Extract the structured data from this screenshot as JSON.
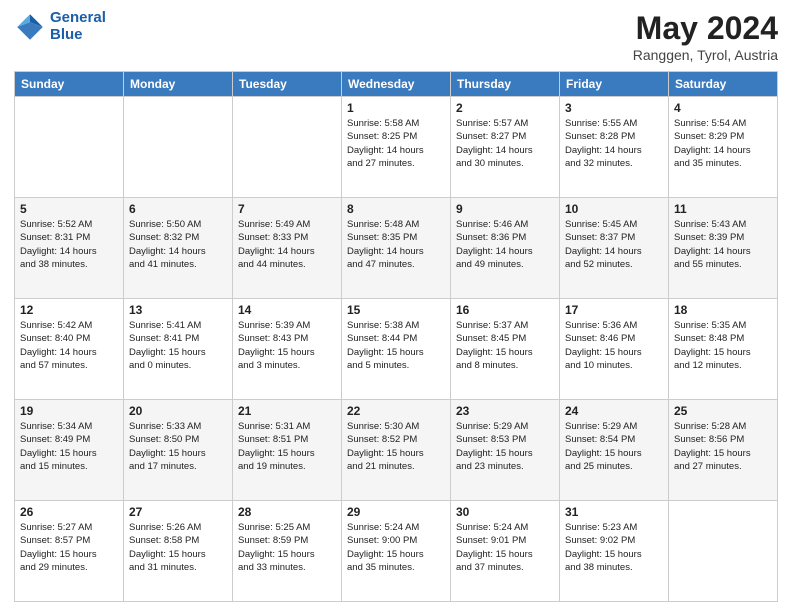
{
  "header": {
    "logo_line1": "General",
    "logo_line2": "Blue",
    "title": "May 2024",
    "location": "Ranggen, Tyrol, Austria"
  },
  "weekdays": [
    "Sunday",
    "Monday",
    "Tuesday",
    "Wednesday",
    "Thursday",
    "Friday",
    "Saturday"
  ],
  "weeks": [
    [
      {
        "day": "",
        "info": ""
      },
      {
        "day": "",
        "info": ""
      },
      {
        "day": "",
        "info": ""
      },
      {
        "day": "1",
        "info": "Sunrise: 5:58 AM\nSunset: 8:25 PM\nDaylight: 14 hours\nand 27 minutes."
      },
      {
        "day": "2",
        "info": "Sunrise: 5:57 AM\nSunset: 8:27 PM\nDaylight: 14 hours\nand 30 minutes."
      },
      {
        "day": "3",
        "info": "Sunrise: 5:55 AM\nSunset: 8:28 PM\nDaylight: 14 hours\nand 32 minutes."
      },
      {
        "day": "4",
        "info": "Sunrise: 5:54 AM\nSunset: 8:29 PM\nDaylight: 14 hours\nand 35 minutes."
      }
    ],
    [
      {
        "day": "5",
        "info": "Sunrise: 5:52 AM\nSunset: 8:31 PM\nDaylight: 14 hours\nand 38 minutes."
      },
      {
        "day": "6",
        "info": "Sunrise: 5:50 AM\nSunset: 8:32 PM\nDaylight: 14 hours\nand 41 minutes."
      },
      {
        "day": "7",
        "info": "Sunrise: 5:49 AM\nSunset: 8:33 PM\nDaylight: 14 hours\nand 44 minutes."
      },
      {
        "day": "8",
        "info": "Sunrise: 5:48 AM\nSunset: 8:35 PM\nDaylight: 14 hours\nand 47 minutes."
      },
      {
        "day": "9",
        "info": "Sunrise: 5:46 AM\nSunset: 8:36 PM\nDaylight: 14 hours\nand 49 minutes."
      },
      {
        "day": "10",
        "info": "Sunrise: 5:45 AM\nSunset: 8:37 PM\nDaylight: 14 hours\nand 52 minutes."
      },
      {
        "day": "11",
        "info": "Sunrise: 5:43 AM\nSunset: 8:39 PM\nDaylight: 14 hours\nand 55 minutes."
      }
    ],
    [
      {
        "day": "12",
        "info": "Sunrise: 5:42 AM\nSunset: 8:40 PM\nDaylight: 14 hours\nand 57 minutes."
      },
      {
        "day": "13",
        "info": "Sunrise: 5:41 AM\nSunset: 8:41 PM\nDaylight: 15 hours\nand 0 minutes."
      },
      {
        "day": "14",
        "info": "Sunrise: 5:39 AM\nSunset: 8:43 PM\nDaylight: 15 hours\nand 3 minutes."
      },
      {
        "day": "15",
        "info": "Sunrise: 5:38 AM\nSunset: 8:44 PM\nDaylight: 15 hours\nand 5 minutes."
      },
      {
        "day": "16",
        "info": "Sunrise: 5:37 AM\nSunset: 8:45 PM\nDaylight: 15 hours\nand 8 minutes."
      },
      {
        "day": "17",
        "info": "Sunrise: 5:36 AM\nSunset: 8:46 PM\nDaylight: 15 hours\nand 10 minutes."
      },
      {
        "day": "18",
        "info": "Sunrise: 5:35 AM\nSunset: 8:48 PM\nDaylight: 15 hours\nand 12 minutes."
      }
    ],
    [
      {
        "day": "19",
        "info": "Sunrise: 5:34 AM\nSunset: 8:49 PM\nDaylight: 15 hours\nand 15 minutes."
      },
      {
        "day": "20",
        "info": "Sunrise: 5:33 AM\nSunset: 8:50 PM\nDaylight: 15 hours\nand 17 minutes."
      },
      {
        "day": "21",
        "info": "Sunrise: 5:31 AM\nSunset: 8:51 PM\nDaylight: 15 hours\nand 19 minutes."
      },
      {
        "day": "22",
        "info": "Sunrise: 5:30 AM\nSunset: 8:52 PM\nDaylight: 15 hours\nand 21 minutes."
      },
      {
        "day": "23",
        "info": "Sunrise: 5:29 AM\nSunset: 8:53 PM\nDaylight: 15 hours\nand 23 minutes."
      },
      {
        "day": "24",
        "info": "Sunrise: 5:29 AM\nSunset: 8:54 PM\nDaylight: 15 hours\nand 25 minutes."
      },
      {
        "day": "25",
        "info": "Sunrise: 5:28 AM\nSunset: 8:56 PM\nDaylight: 15 hours\nand 27 minutes."
      }
    ],
    [
      {
        "day": "26",
        "info": "Sunrise: 5:27 AM\nSunset: 8:57 PM\nDaylight: 15 hours\nand 29 minutes."
      },
      {
        "day": "27",
        "info": "Sunrise: 5:26 AM\nSunset: 8:58 PM\nDaylight: 15 hours\nand 31 minutes."
      },
      {
        "day": "28",
        "info": "Sunrise: 5:25 AM\nSunset: 8:59 PM\nDaylight: 15 hours\nand 33 minutes."
      },
      {
        "day": "29",
        "info": "Sunrise: 5:24 AM\nSunset: 9:00 PM\nDaylight: 15 hours\nand 35 minutes."
      },
      {
        "day": "30",
        "info": "Sunrise: 5:24 AM\nSunset: 9:01 PM\nDaylight: 15 hours\nand 37 minutes."
      },
      {
        "day": "31",
        "info": "Sunrise: 5:23 AM\nSunset: 9:02 PM\nDaylight: 15 hours\nand 38 minutes."
      },
      {
        "day": "",
        "info": ""
      }
    ]
  ]
}
